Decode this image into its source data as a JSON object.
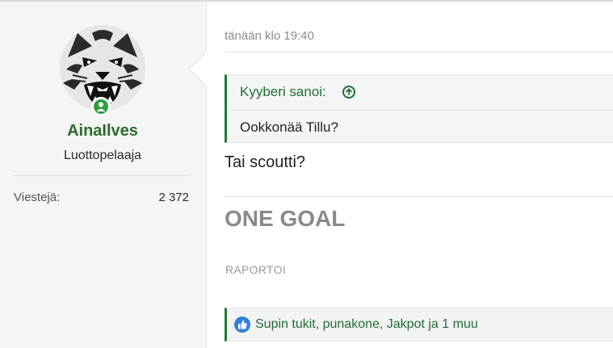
{
  "user": {
    "name": "AinaIlves",
    "title": "Luottopelaaja",
    "stats": [
      {
        "label": "Viestejä:",
        "value": "2 372"
      }
    ]
  },
  "post": {
    "timestamp": "tänään klo 19:40",
    "quote": {
      "author": "Kyyberi sanoi:",
      "text": "Ookkonää Tillu?"
    },
    "body": "Tai scoutti?",
    "signature": "ONE GOAL",
    "report_label": "RAPORTOI",
    "likes": "Supin tukit, punakone, Jakpot ja 1 muu"
  },
  "colors": {
    "accent": "#1e7a35",
    "username": "#2a6b2a",
    "online": "#2e9e3e",
    "like": "#2f80d8"
  },
  "icons": {
    "avatar": "tiger-face",
    "online": "user-online-icon",
    "quote_jump": "arrow-up-circle-icon",
    "like": "thumbs-up-icon"
  }
}
